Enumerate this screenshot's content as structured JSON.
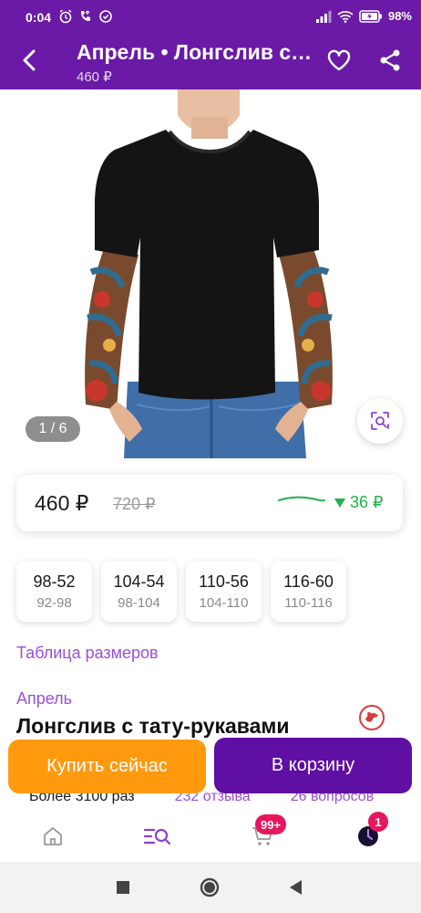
{
  "status_bar": {
    "time": "0:04",
    "battery": "98%",
    "icons_left": [
      "alarm-icon",
      "call-icon",
      "sync-icon"
    ],
    "icons_right": [
      "signal-icon",
      "wifi-icon",
      "battery-icon"
    ]
  },
  "header": {
    "title": "Апрель • Лонгслив с тату-рукавами",
    "price": "460 ₽"
  },
  "gallery": {
    "counter": "1 / 6"
  },
  "price_card": {
    "current": "460 ₽",
    "old": "720 ₽",
    "drop": "36 ₽"
  },
  "sizes": [
    {
      "main": "98-52",
      "sub": "92-98"
    },
    {
      "main": "104-54",
      "sub": "98-104"
    },
    {
      "main": "110-56",
      "sub": "104-110"
    },
    {
      "main": "116-60",
      "sub": "110-116"
    }
  ],
  "size_table_label": "Таблица размеров",
  "product": {
    "brand": "Апрель",
    "title": "Лонгслив с тату-рукавами"
  },
  "stats": {
    "orders": "Более 3100 раз",
    "reviews": "232 отзыва",
    "questions": "26 вопросов"
  },
  "actions": {
    "buy_now": "Купить сейчас",
    "to_cart": "В корзину"
  },
  "bottom_nav": {
    "cart_badge": "99+",
    "profile_badge": "1"
  },
  "colors": {
    "brand_purple": "#6a1aa6",
    "buy_orange": "#ff9a0f",
    "cart_purple": "#5f0fa3",
    "link_purple": "#9a4fd6",
    "price_drop_green": "#22b14c",
    "badge_pink": "#e8175d"
  }
}
